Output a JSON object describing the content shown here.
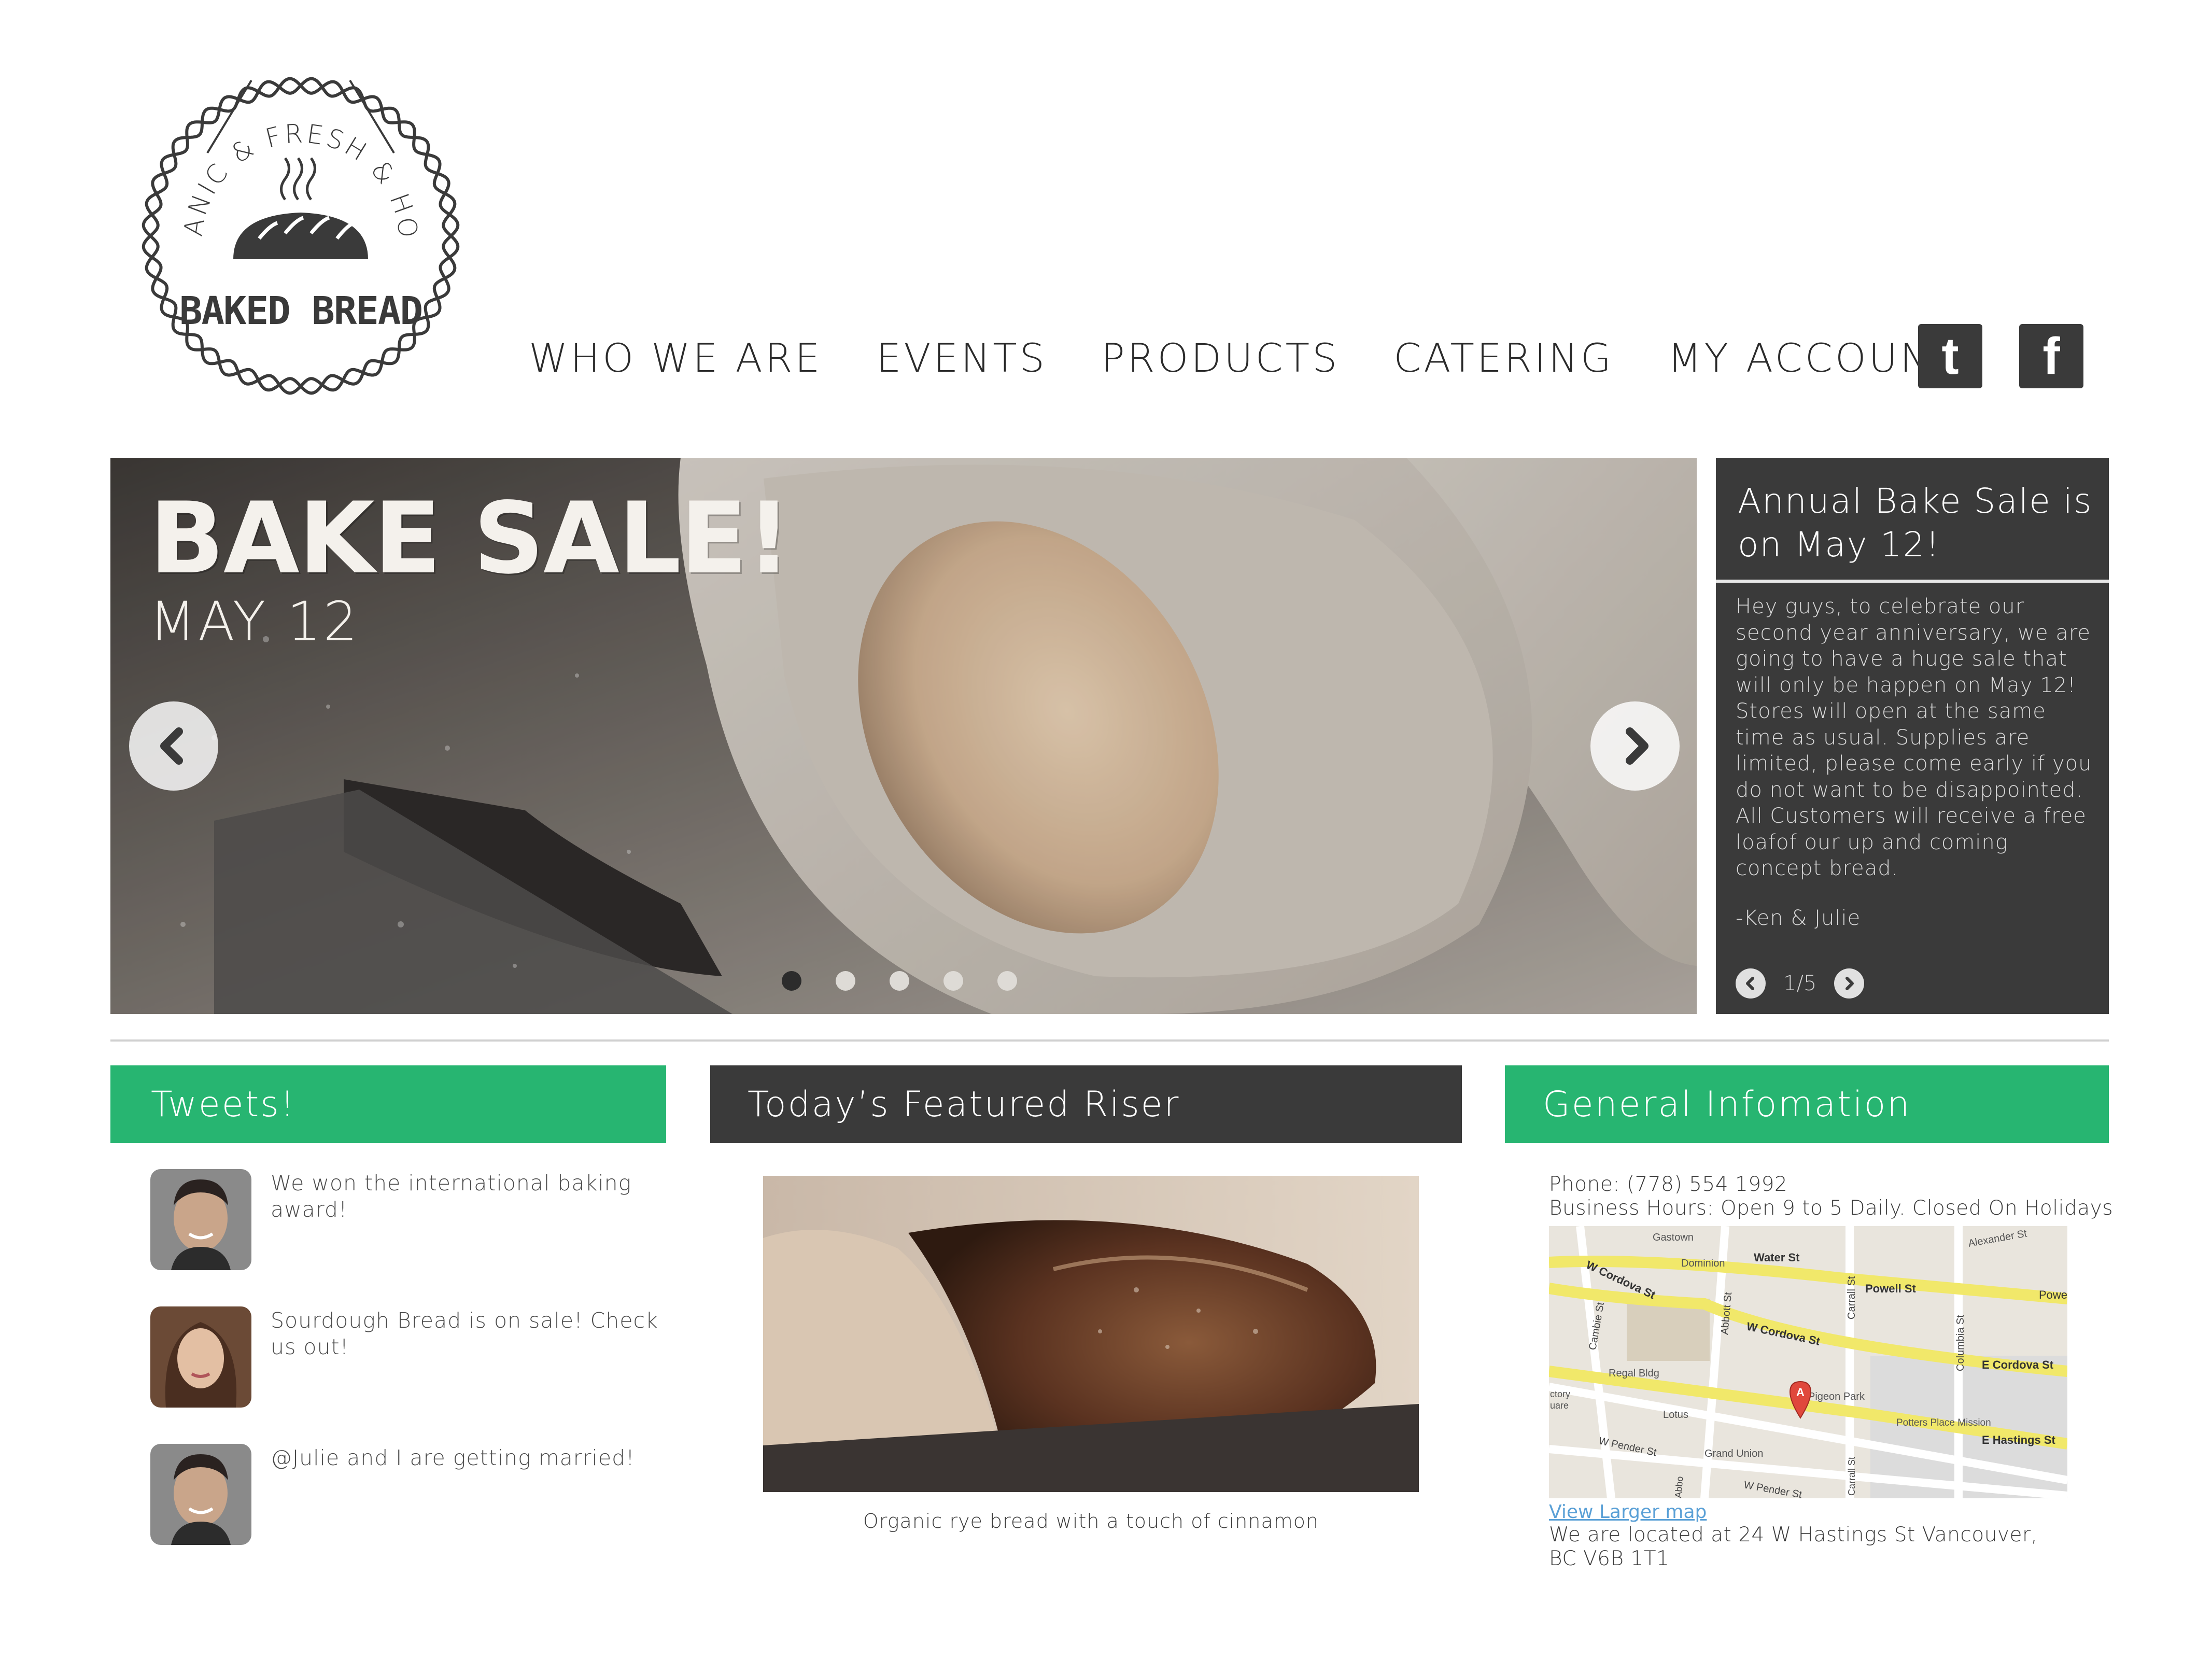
{
  "logo": {
    "arc_text": "ORGANIC & FRESH & HOMEY",
    "name": "BAKED BREAD"
  },
  "nav": {
    "items": [
      "WHO WE ARE",
      "EVENTS",
      "PRODUCTS",
      "CATERING",
      "MY ACCOUNT"
    ],
    "twitter_icon": "twitter-icon",
    "twitter_glyph": "t",
    "facebook_icon": "facebook-icon",
    "facebook_glyph": "f"
  },
  "hero": {
    "title": "BAKE SALE!",
    "date": "MAY 12",
    "slide_count": 5,
    "active_slide": 1
  },
  "news": {
    "title": "Annual Bake Sale is on May 12!",
    "body": "Hey guys, to celebrate our second year anniversary, we are going to have a huge sale that will only be happen on May 12! Stores will open at the same time as usual. Supplies are limited, please come early if you do not want to be disappointed. All Customers will receive a free loafof our up and coming concept bread.",
    "signature": "-Ken & Julie",
    "pager": "1/5"
  },
  "tweets": {
    "heading": "Tweets!",
    "items": [
      {
        "text": "We won the international baking award!"
      },
      {
        "text": "Sourdough Bread is on sale! Check us out!"
      },
      {
        "text": "@Julie and I are getting married!"
      }
    ]
  },
  "featured": {
    "heading": "Today’s Featured Riser",
    "caption": "Organic rye bread with a touch of cinnamon"
  },
  "info": {
    "heading": "General Infomation",
    "phone": "Phone: (778) 554 1992",
    "hours": "Business Hours: Open 9 to 5 Daily. Closed On Holidays",
    "map_link": "View Larger map",
    "address": "We are located at 24 W Hastings St  Vancouver, BC V6B 1T1",
    "map_labels": [
      "Gastown",
      "Dominion",
      "Water St",
      "Powell St",
      "Alexander St",
      "Powe",
      "W Cordova St",
      "W Cordova St",
      "E Cordova St",
      "Cambie St",
      "Abbott St",
      "Carrall St",
      "Columbia St",
      "Regal Bldg",
      "Pigeon Park",
      "Potters Place Mission",
      "E Hastings St",
      "Lotus",
      "Grand Union",
      "W Pender St",
      "W Pender St",
      "ctory",
      "uare",
      "Abbo",
      "Carrall St",
      "A"
    ]
  },
  "colors": {
    "green": "#27b571",
    "dark": "#3a3a3a",
    "text": "#3a3a3a"
  }
}
